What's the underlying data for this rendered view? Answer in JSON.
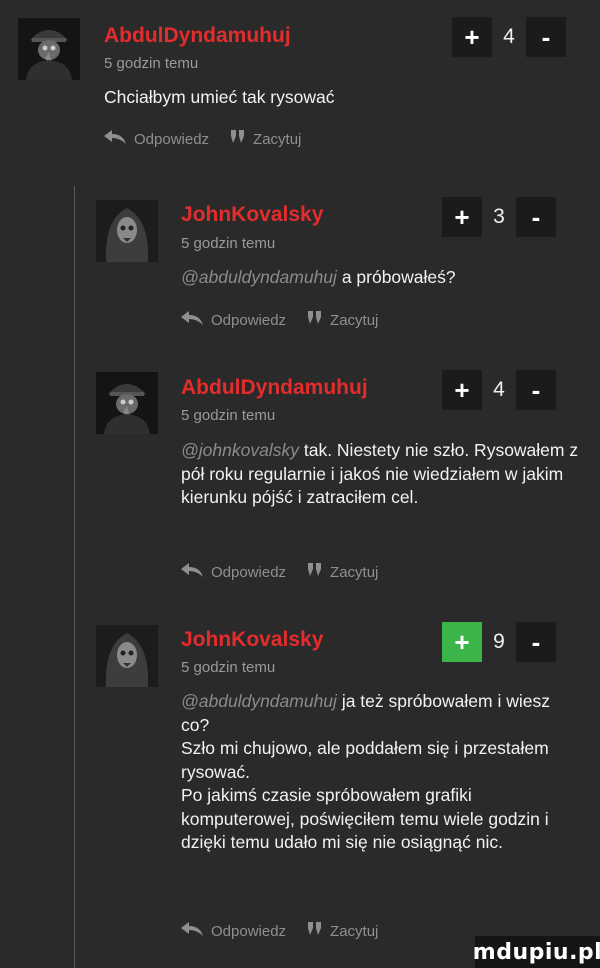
{
  "colors": {
    "author": "#e42c2c",
    "upvote_active": "#3bb54a",
    "button_bg": "#1b1b1b"
  },
  "comments": [
    {
      "author": "AbdulDyndamuhuj",
      "time": "5 godzin temu",
      "mention": "",
      "text": "Chciałbym umieć tak rysować",
      "votes": "4",
      "plus": "+",
      "minus": "-",
      "reply": "Odpowiedz",
      "quote": "Zacytuj"
    },
    {
      "author": "JohnKovalsky",
      "time": "5 godzin temu",
      "mention": "@abduldyndamuhuj",
      "text": "a próbowałeś?",
      "votes": "3",
      "plus": "+",
      "minus": "-",
      "reply": "Odpowiedz",
      "quote": "Zacytuj"
    },
    {
      "author": "AbdulDyndamuhuj",
      "time": "5 godzin temu",
      "mention": "@johnkovalsky",
      "text": "tak. Niestety nie szło. Rysowałem z pół roku regularnie i jakoś nie wiedziałem w jakim kierunku pójść i zatraciłem cel.",
      "votes": "4",
      "plus": "+",
      "minus": "-",
      "reply": "Odpowiedz",
      "quote": "Zacytuj"
    },
    {
      "author": "JohnKovalsky",
      "time": "5 godzin temu",
      "mention": "@abduldyndamuhuj",
      "text": "ja też spróbowałem i wiesz co?\nSzło mi chujowo, ale poddałem się i przestałem rysować.\nPo jakimś czasie spróbowałem grafiki komputerowej, poświęciłem temu wiele godzin i dzięki temu udało mi się nie osiągnąć nic.",
      "votes": "9",
      "plus": "+",
      "minus": "-",
      "reply": "Odpowiedz",
      "quote": "Zacytuj"
    }
  ],
  "watermark": "mdupiu.pl"
}
